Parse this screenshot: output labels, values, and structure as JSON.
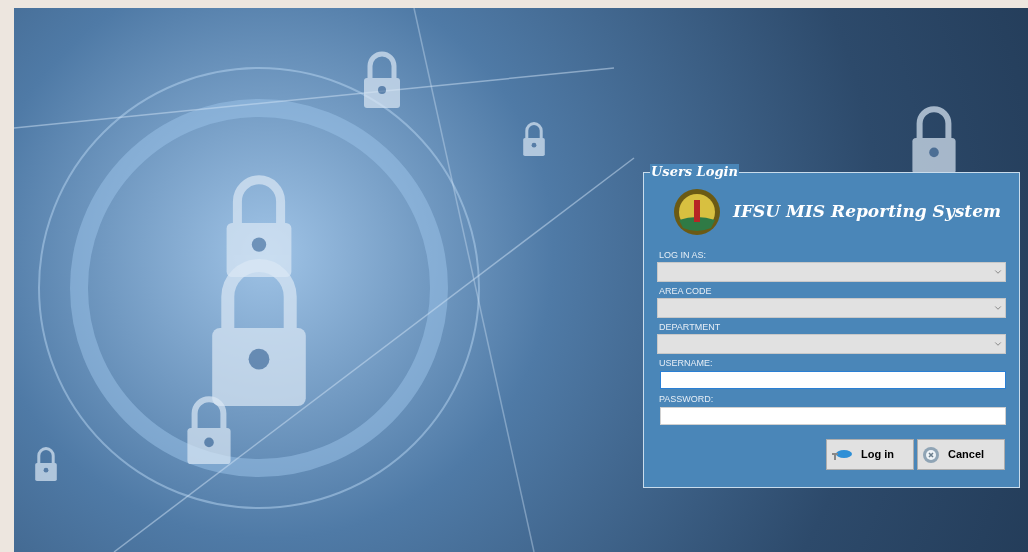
{
  "login": {
    "group_title": "Users Login",
    "app_title": "IFSU MIS Reporting System",
    "fields": [
      {
        "kind": "dropdown",
        "label": "LOG IN AS:",
        "focused": false
      },
      {
        "kind": "dropdown",
        "label": "AREA CODE",
        "focused": false
      },
      {
        "kind": "dropdown",
        "label": "DEPARTMENT",
        "focused": false
      },
      {
        "kind": "text",
        "label": "USERNAME:",
        "focused": true
      },
      {
        "kind": "text",
        "label": "PASSWORD:",
        "focused": false
      }
    ],
    "buttons": [
      {
        "kind": "login",
        "label": "Log in"
      },
      {
        "kind": "cancel",
        "label": "Cancel"
      }
    ]
  }
}
